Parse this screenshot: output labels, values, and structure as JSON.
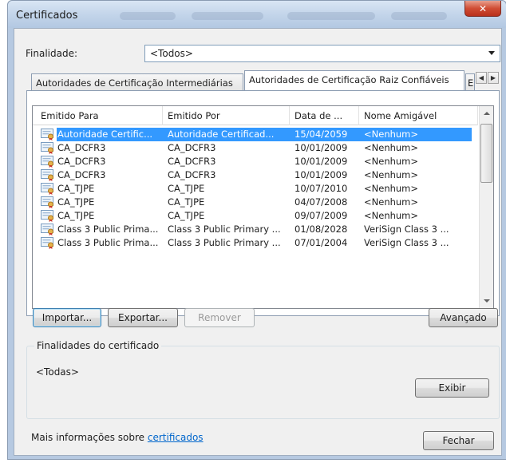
{
  "window": {
    "title": "Certificados",
    "close_symbol": "✕"
  },
  "purpose": {
    "label": "Finalidade:",
    "value": "<Todos>"
  },
  "tabs": [
    {
      "label": "Autoridades de Certificação Intermediárias"
    },
    {
      "label": "Autoridades de Certificação Raiz Confiáveis"
    },
    {
      "label": "E"
    }
  ],
  "list": {
    "columns": [
      "Emitido Para",
      "Emitido Por",
      "Data de ...",
      "Nome Amigável"
    ],
    "rows": [
      {
        "issued_to": "Autoridade Certific...",
        "issued_by": "Autoridade Certificad...",
        "date": "15/04/2059",
        "friendly": "<Nenhum>",
        "selected": true
      },
      {
        "issued_to": "CA_DCFR3",
        "issued_by": "CA_DCFR3",
        "date": "10/01/2009",
        "friendly": "<Nenhum>"
      },
      {
        "issued_to": "CA_DCFR3",
        "issued_by": "CA_DCFR3",
        "date": "10/01/2009",
        "friendly": "<Nenhum>"
      },
      {
        "issued_to": "CA_DCFR3",
        "issued_by": "CA_DCFR3",
        "date": "10/01/2009",
        "friendly": "<Nenhum>"
      },
      {
        "issued_to": "CA_TJPE",
        "issued_by": "CA_TJPE",
        "date": "10/07/2010",
        "friendly": "<Nenhum>"
      },
      {
        "issued_to": "CA_TJPE",
        "issued_by": "CA_TJPE",
        "date": "04/07/2008",
        "friendly": "<Nenhum>"
      },
      {
        "issued_to": "CA_TJPE",
        "issued_by": "CA_TJPE",
        "date": "09/07/2009",
        "friendly": "<Nenhum>"
      },
      {
        "issued_to": "Class 3 Public Prima...",
        "issued_by": "Class 3 Public Primary ...",
        "date": "01/08/2028",
        "friendly": "VeriSign Class 3 ..."
      },
      {
        "issued_to": "Class 3 Public Prima...",
        "issued_by": "Class 3 Public Primary ...",
        "date": "07/01/2004",
        "friendly": "VeriSign Class 3 ..."
      }
    ]
  },
  "buttons": {
    "import": "Importar...",
    "export": "Exportar...",
    "remove": "Remover",
    "advanced": "Avançado",
    "view": "Exibir",
    "close": "Fechar"
  },
  "purposes_group": {
    "title": "Finalidades do certificado",
    "value": "<Todas>"
  },
  "footer": {
    "text": "Mais informações sobre ",
    "link": "certificados"
  },
  "colors": {
    "selection": "#3399ff",
    "link": "#0066cc",
    "close_button": "#d04d34"
  },
  "icons": {
    "certificate": "certificate-icon",
    "close": "close-icon",
    "dropdown": "chevron-down-icon"
  }
}
